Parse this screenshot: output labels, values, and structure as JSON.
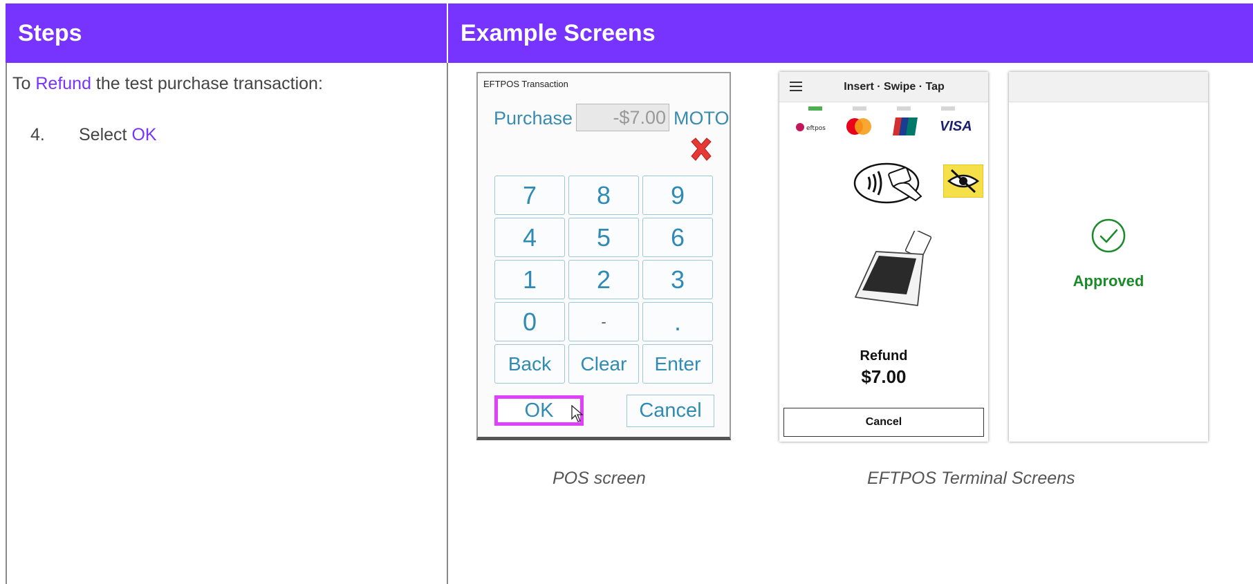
{
  "header": {
    "steps_label": "Steps",
    "examples_label": "Example Screens"
  },
  "steps": {
    "intro_prefix": "To ",
    "intro_link": "Refund",
    "intro_suffix": " the test purchase transaction:",
    "step_number": "4.",
    "step_prefix": "Select ",
    "step_link": "OK"
  },
  "pos": {
    "window_title": "EFTPOS Transaction",
    "purchase_label": "Purchase",
    "amount": "-$7.00",
    "moto_label": "MOTO",
    "keys": [
      "7",
      "8",
      "9",
      "4",
      "5",
      "6",
      "1",
      "2",
      "3",
      "0",
      "-",
      ".",
      "Back",
      "Clear",
      "Enter"
    ],
    "ok_label": "OK",
    "cancel_label": "Cancel"
  },
  "terminal1": {
    "title": "Insert · Swipe · Tap",
    "card_brands": [
      "eftpos",
      "mastercard",
      "unionpay",
      "VISA"
    ],
    "refund_label": "Refund",
    "amount": "$7.00",
    "cancel_label": "Cancel"
  },
  "terminal2": {
    "status": "Approved"
  },
  "captions": {
    "pos": "POS screen",
    "terminal": "EFTPOS Terminal Screens"
  },
  "colors": {
    "accent": "#7733ff",
    "highlight": "#e040fb",
    "pos_text": "#2f8bb5",
    "approved": "#1a8a2a"
  }
}
